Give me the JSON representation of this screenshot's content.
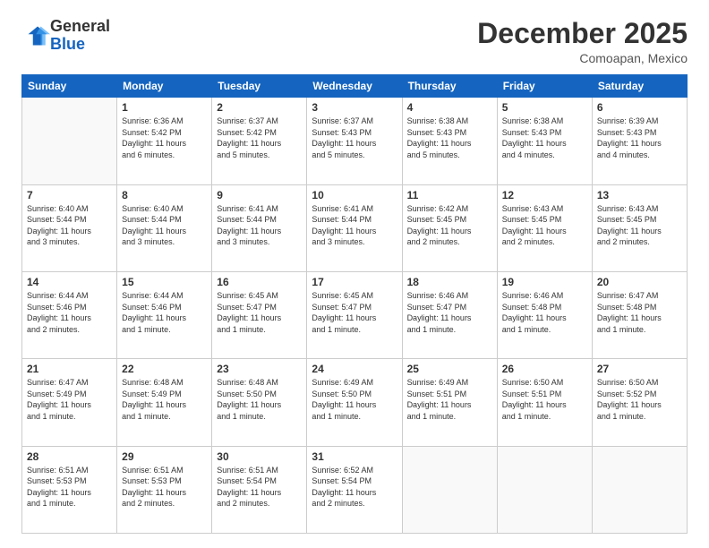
{
  "logo": {
    "general": "General",
    "blue": "Blue"
  },
  "title": "December 2025",
  "location": "Comoapan, Mexico",
  "days_of_week": [
    "Sunday",
    "Monday",
    "Tuesday",
    "Wednesday",
    "Thursday",
    "Friday",
    "Saturday"
  ],
  "weeks": [
    [
      {
        "day": "",
        "info": ""
      },
      {
        "day": "1",
        "info": "Sunrise: 6:36 AM\nSunset: 5:42 PM\nDaylight: 11 hours\nand 6 minutes."
      },
      {
        "day": "2",
        "info": "Sunrise: 6:37 AM\nSunset: 5:42 PM\nDaylight: 11 hours\nand 5 minutes."
      },
      {
        "day": "3",
        "info": "Sunrise: 6:37 AM\nSunset: 5:43 PM\nDaylight: 11 hours\nand 5 minutes."
      },
      {
        "day": "4",
        "info": "Sunrise: 6:38 AM\nSunset: 5:43 PM\nDaylight: 11 hours\nand 5 minutes."
      },
      {
        "day": "5",
        "info": "Sunrise: 6:38 AM\nSunset: 5:43 PM\nDaylight: 11 hours\nand 4 minutes."
      },
      {
        "day": "6",
        "info": "Sunrise: 6:39 AM\nSunset: 5:43 PM\nDaylight: 11 hours\nand 4 minutes."
      }
    ],
    [
      {
        "day": "7",
        "info": "Sunrise: 6:40 AM\nSunset: 5:44 PM\nDaylight: 11 hours\nand 3 minutes."
      },
      {
        "day": "8",
        "info": "Sunrise: 6:40 AM\nSunset: 5:44 PM\nDaylight: 11 hours\nand 3 minutes."
      },
      {
        "day": "9",
        "info": "Sunrise: 6:41 AM\nSunset: 5:44 PM\nDaylight: 11 hours\nand 3 minutes."
      },
      {
        "day": "10",
        "info": "Sunrise: 6:41 AM\nSunset: 5:44 PM\nDaylight: 11 hours\nand 3 minutes."
      },
      {
        "day": "11",
        "info": "Sunrise: 6:42 AM\nSunset: 5:45 PM\nDaylight: 11 hours\nand 2 minutes."
      },
      {
        "day": "12",
        "info": "Sunrise: 6:43 AM\nSunset: 5:45 PM\nDaylight: 11 hours\nand 2 minutes."
      },
      {
        "day": "13",
        "info": "Sunrise: 6:43 AM\nSunset: 5:45 PM\nDaylight: 11 hours\nand 2 minutes."
      }
    ],
    [
      {
        "day": "14",
        "info": "Sunrise: 6:44 AM\nSunset: 5:46 PM\nDaylight: 11 hours\nand 2 minutes."
      },
      {
        "day": "15",
        "info": "Sunrise: 6:44 AM\nSunset: 5:46 PM\nDaylight: 11 hours\nand 1 minute."
      },
      {
        "day": "16",
        "info": "Sunrise: 6:45 AM\nSunset: 5:47 PM\nDaylight: 11 hours\nand 1 minute."
      },
      {
        "day": "17",
        "info": "Sunrise: 6:45 AM\nSunset: 5:47 PM\nDaylight: 11 hours\nand 1 minute."
      },
      {
        "day": "18",
        "info": "Sunrise: 6:46 AM\nSunset: 5:47 PM\nDaylight: 11 hours\nand 1 minute."
      },
      {
        "day": "19",
        "info": "Sunrise: 6:46 AM\nSunset: 5:48 PM\nDaylight: 11 hours\nand 1 minute."
      },
      {
        "day": "20",
        "info": "Sunrise: 6:47 AM\nSunset: 5:48 PM\nDaylight: 11 hours\nand 1 minute."
      }
    ],
    [
      {
        "day": "21",
        "info": "Sunrise: 6:47 AM\nSunset: 5:49 PM\nDaylight: 11 hours\nand 1 minute."
      },
      {
        "day": "22",
        "info": "Sunrise: 6:48 AM\nSunset: 5:49 PM\nDaylight: 11 hours\nand 1 minute."
      },
      {
        "day": "23",
        "info": "Sunrise: 6:48 AM\nSunset: 5:50 PM\nDaylight: 11 hours\nand 1 minute."
      },
      {
        "day": "24",
        "info": "Sunrise: 6:49 AM\nSunset: 5:50 PM\nDaylight: 11 hours\nand 1 minute."
      },
      {
        "day": "25",
        "info": "Sunrise: 6:49 AM\nSunset: 5:51 PM\nDaylight: 11 hours\nand 1 minute."
      },
      {
        "day": "26",
        "info": "Sunrise: 6:50 AM\nSunset: 5:51 PM\nDaylight: 11 hours\nand 1 minute."
      },
      {
        "day": "27",
        "info": "Sunrise: 6:50 AM\nSunset: 5:52 PM\nDaylight: 11 hours\nand 1 minute."
      }
    ],
    [
      {
        "day": "28",
        "info": "Sunrise: 6:51 AM\nSunset: 5:53 PM\nDaylight: 11 hours\nand 1 minute."
      },
      {
        "day": "29",
        "info": "Sunrise: 6:51 AM\nSunset: 5:53 PM\nDaylight: 11 hours\nand 2 minutes."
      },
      {
        "day": "30",
        "info": "Sunrise: 6:51 AM\nSunset: 5:54 PM\nDaylight: 11 hours\nand 2 minutes."
      },
      {
        "day": "31",
        "info": "Sunrise: 6:52 AM\nSunset: 5:54 PM\nDaylight: 11 hours\nand 2 minutes."
      },
      {
        "day": "",
        "info": ""
      },
      {
        "day": "",
        "info": ""
      },
      {
        "day": "",
        "info": ""
      }
    ]
  ]
}
